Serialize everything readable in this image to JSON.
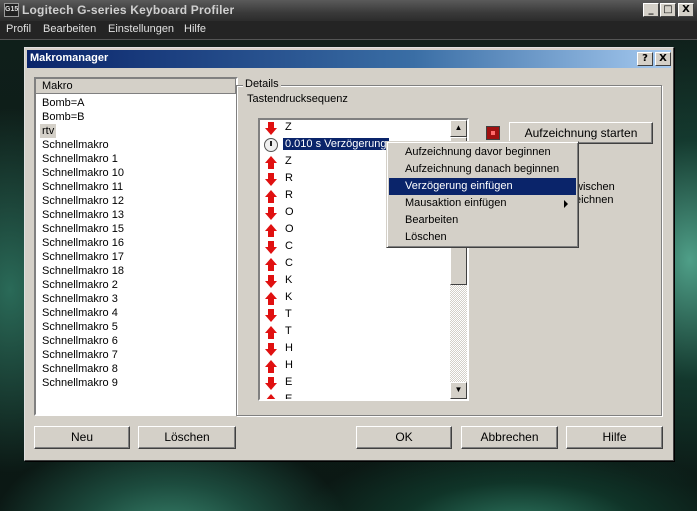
{
  "app": {
    "title": "Logitech G-series Keyboard Profiler",
    "icon_text": "G15",
    "window_buttons": [
      "_",
      "□",
      "X"
    ]
  },
  "menubar": [
    "Profil",
    "Bearbeiten",
    "Einstellungen",
    "Hilfe"
  ],
  "dialog": {
    "title": "Makromanager",
    "help_label": "?",
    "close_label": "X"
  },
  "macro_list": {
    "header": "Makro",
    "items": [
      "Bomb=A",
      "Bomb=B",
      "rtv",
      "Schnellmakro",
      "Schnellmakro 1",
      "Schnellmakro 10",
      "Schnellmakro 11",
      "Schnellmakro 12",
      "Schnellmakro 13",
      "Schnellmakro 15",
      "Schnellmakro 16",
      "Schnellmakro 17",
      "Schnellmakro 18",
      "Schnellmakro 2",
      "Schnellmakro 3",
      "Schnellmakro 4",
      "Schnellmakro 5",
      "Schnellmakro 6",
      "Schnellmakro 7",
      "Schnellmakro 8",
      "Schnellmakro 9"
    ],
    "selected": "rtv"
  },
  "details": {
    "group_label": "Details",
    "sequence_label": "Tastendrucksequenz",
    "sequence": [
      {
        "type": "down",
        "key": "Z"
      },
      {
        "type": "delay",
        "key": "0.010 s Verzögerung"
      },
      {
        "type": "up",
        "key": "Z"
      },
      {
        "type": "down",
        "key": "R"
      },
      {
        "type": "up",
        "key": "R"
      },
      {
        "type": "down",
        "key": "O"
      },
      {
        "type": "up",
        "key": "O"
      },
      {
        "type": "down",
        "key": "C"
      },
      {
        "type": "up",
        "key": "C"
      },
      {
        "type": "down",
        "key": "K"
      },
      {
        "type": "up",
        "key": "K"
      },
      {
        "type": "down",
        "key": "T"
      },
      {
        "type": "up",
        "key": "T"
      },
      {
        "type": "down",
        "key": "H"
      },
      {
        "type": "up",
        "key": "H"
      },
      {
        "type": "down",
        "key": "E"
      },
      {
        "type": "up",
        "key": "E"
      }
    ],
    "record_button": "Aufzeichnung starten",
    "option_fragment_1": "wischen",
    "option_fragment_2": "eichnen",
    "scroll_up": "▲",
    "scroll_down": "▼"
  },
  "context_menu": {
    "items": [
      "Aufzeichnung davor beginnen",
      "Aufzeichnung danach beginnen",
      "Verzögerung einfügen",
      "Mausaktion einfügen",
      "Bearbeiten",
      "Löschen"
    ],
    "highlighted": "Verzögerung einfügen",
    "submenu": "Mausaktion einfügen"
  },
  "buttons": {
    "new": "Neu",
    "delete": "Löschen",
    "ok": "OK",
    "cancel": "Abbrechen",
    "help": "Hilfe"
  }
}
